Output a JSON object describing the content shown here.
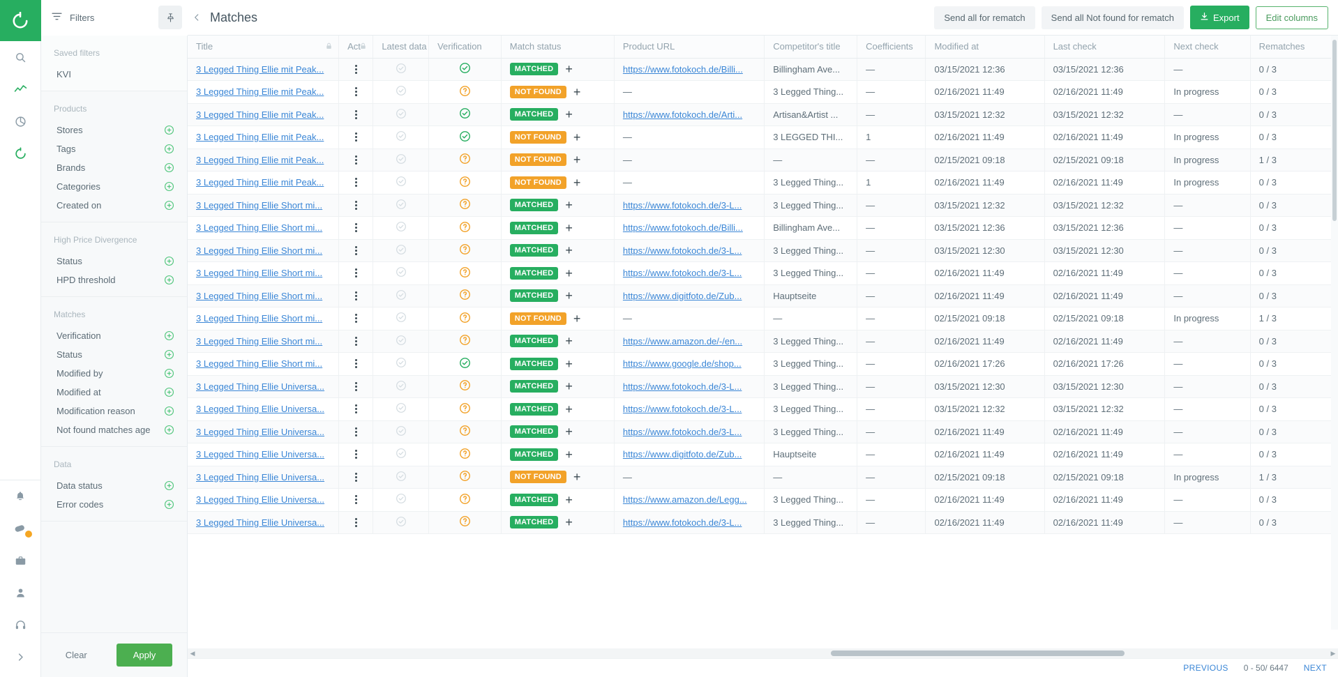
{
  "brand": {
    "logo_icon": "refresh-circle-logo",
    "accent": "#27ae60"
  },
  "rail": {
    "items": [
      {
        "name": "search",
        "icon": "search-icon"
      },
      {
        "name": "analytics",
        "icon": "chart-line-icon"
      },
      {
        "name": "reports",
        "icon": "pie-chart-icon"
      },
      {
        "name": "matches",
        "icon": "refresh-icon"
      }
    ],
    "bottom_items": [
      {
        "name": "notifications",
        "icon": "bell-icon"
      },
      {
        "name": "tasks",
        "icon": "tag-check-icon",
        "badge": true
      },
      {
        "name": "catalog",
        "icon": "briefcase-icon"
      },
      {
        "name": "users",
        "icon": "person-icon"
      },
      {
        "name": "support",
        "icon": "headset-icon"
      },
      {
        "name": "expand",
        "icon": "chevron-right-icon"
      }
    ]
  },
  "topbar": {
    "filters_label": "Filters",
    "filter_icon": "filter-icon",
    "pin_icon": "pin-icon",
    "collapse_icon": "chevron-left-icon",
    "page_title": "Matches",
    "actions": {
      "send_all": "Send all for rematch",
      "send_not_found": "Send all Not found for rematch",
      "export": "Export",
      "export_icon": "download-icon",
      "edit_columns": "Edit columns"
    }
  },
  "filters": {
    "groups": [
      {
        "title": "Saved filters",
        "has_add": true,
        "items": [
          {
            "label": "KVI",
            "has_add": false
          }
        ]
      },
      {
        "title": "Products",
        "has_add": false,
        "items": [
          {
            "label": "Stores",
            "has_add": true
          },
          {
            "label": "Tags",
            "has_add": true
          },
          {
            "label": "Brands",
            "has_add": true
          },
          {
            "label": "Categories",
            "has_add": true
          },
          {
            "label": "Created on",
            "has_add": true
          }
        ]
      },
      {
        "title": "High Price Divergence",
        "has_add": false,
        "items": [
          {
            "label": "Status",
            "has_add": true
          },
          {
            "label": "HPD threshold",
            "has_add": true
          }
        ]
      },
      {
        "title": "Matches",
        "has_add": false,
        "items": [
          {
            "label": "Verification",
            "has_add": true
          },
          {
            "label": "Status",
            "has_add": true
          },
          {
            "label": "Modified by",
            "has_add": true
          },
          {
            "label": "Modified at",
            "has_add": true
          },
          {
            "label": "Modification reason",
            "has_add": true
          },
          {
            "label": "Not found matches age",
            "has_add": true
          }
        ]
      },
      {
        "title": "Data",
        "has_add": false,
        "items": [
          {
            "label": "Data status",
            "has_add": true
          },
          {
            "label": "Error codes",
            "has_add": true
          }
        ]
      }
    ],
    "clear_label": "Clear",
    "apply_label": "Apply"
  },
  "table": {
    "columns": [
      {
        "key": "title",
        "label": "Title",
        "lock": true
      },
      {
        "key": "actions",
        "label": "Act",
        "lock": true
      },
      {
        "key": "latest_data",
        "label": "Latest data ...",
        "lock": false
      },
      {
        "key": "verification",
        "label": "Verification",
        "lock": false
      },
      {
        "key": "match_status",
        "label": "Match status",
        "lock": false
      },
      {
        "key": "product_url",
        "label": "Product URL",
        "lock": false
      },
      {
        "key": "competitor_title",
        "label": "Competitor's title",
        "lock": false
      },
      {
        "key": "coefficients",
        "label": "Coefficients",
        "lock": false
      },
      {
        "key": "modified_at",
        "label": "Modified at",
        "lock": false
      },
      {
        "key": "last_check",
        "label": "Last check",
        "lock": false
      },
      {
        "key": "next_check",
        "label": "Next check",
        "lock": false
      },
      {
        "key": "rematches",
        "label": "Rematches",
        "lock": false
      }
    ],
    "rows": [
      {
        "title": "3 Legged Thing Ellie mit Peak...",
        "latest_data": "check-circle-grey-icon",
        "verification": "check-circle-green-icon",
        "match_status": "MATCHED",
        "product_url": "https://www.fotokoch.de/Billi...",
        "competitor_title": "Billingham Ave...",
        "coefficients": "—",
        "modified_at": "03/15/2021 12:36",
        "last_check": "03/15/2021 12:36",
        "next_check": "—",
        "rematches": "0 / 3"
      },
      {
        "title": "3 Legged Thing Ellie mit Peak...",
        "latest_data": "check-circle-grey-icon",
        "verification": "question-circle-orange-icon",
        "match_status": "NOT FOUND",
        "product_url": "—",
        "competitor_title": "3 Legged Thing...",
        "coefficients": "—",
        "modified_at": "02/16/2021 11:49",
        "last_check": "02/16/2021 11:49",
        "next_check": "In progress",
        "rematches": "0 / 3"
      },
      {
        "title": "3 Legged Thing Ellie mit Peak...",
        "latest_data": "check-circle-grey-icon",
        "verification": "check-circle-green-icon",
        "match_status": "MATCHED",
        "product_url": "https://www.fotokoch.de/Arti...",
        "competitor_title": "Artisan&Artist ...",
        "coefficients": "—",
        "modified_at": "03/15/2021 12:32",
        "last_check": "03/15/2021 12:32",
        "next_check": "—",
        "rematches": "0 / 3"
      },
      {
        "title": "3 Legged Thing Ellie mit Peak...",
        "latest_data": "check-circle-grey-icon",
        "verification": "check-circle-green-icon",
        "match_status": "NOT FOUND",
        "product_url": "—",
        "competitor_title": "3 LEGGED THI...",
        "coefficients": "1",
        "modified_at": "02/16/2021 11:49",
        "last_check": "02/16/2021 11:49",
        "next_check": "In progress",
        "rematches": "0 / 3"
      },
      {
        "title": "3 Legged Thing Ellie mit Peak...",
        "latest_data": "check-circle-grey-icon",
        "verification": "question-circle-orange-icon",
        "match_status": "NOT FOUND",
        "product_url": "—",
        "competitor_title": "—",
        "coefficients": "—",
        "modified_at": "02/15/2021 09:18",
        "last_check": "02/15/2021 09:18",
        "next_check": "In progress",
        "rematches": "1 / 3"
      },
      {
        "title": "3 Legged Thing Ellie mit Peak...",
        "latest_data": "check-circle-grey-icon",
        "verification": "question-circle-orange-icon",
        "match_status": "NOT FOUND",
        "product_url": "—",
        "competitor_title": "3 Legged Thing...",
        "coefficients": "1",
        "modified_at": "02/16/2021 11:49",
        "last_check": "02/16/2021 11:49",
        "next_check": "In progress",
        "rematches": "0 / 3"
      },
      {
        "title": "3 Legged Thing Ellie Short mi...",
        "latest_data": "check-circle-grey-icon",
        "verification": "question-circle-orange-icon",
        "match_status": "MATCHED",
        "product_url": "https://www.fotokoch.de/3-L...",
        "competitor_title": "3 Legged Thing...",
        "coefficients": "—",
        "modified_at": "03/15/2021 12:32",
        "last_check": "03/15/2021 12:32",
        "next_check": "—",
        "rematches": "0 / 3"
      },
      {
        "title": "3 Legged Thing Ellie Short mi...",
        "latest_data": "check-circle-grey-icon",
        "verification": "question-circle-orange-icon",
        "match_status": "MATCHED",
        "product_url": "https://www.fotokoch.de/Billi...",
        "competitor_title": "Billingham Ave...",
        "coefficients": "—",
        "modified_at": "03/15/2021 12:36",
        "last_check": "03/15/2021 12:36",
        "next_check": "—",
        "rematches": "0 / 3"
      },
      {
        "title": "3 Legged Thing Ellie Short mi...",
        "latest_data": "check-circle-grey-icon",
        "verification": "question-circle-orange-icon",
        "match_status": "MATCHED",
        "product_url": "https://www.fotokoch.de/3-L...",
        "competitor_title": "3 Legged Thing...",
        "coefficients": "—",
        "modified_at": "03/15/2021 12:30",
        "last_check": "03/15/2021 12:30",
        "next_check": "—",
        "rematches": "0 / 3"
      },
      {
        "title": "3 Legged Thing Ellie Short mi...",
        "latest_data": "check-circle-grey-icon",
        "verification": "question-circle-orange-icon",
        "match_status": "MATCHED",
        "product_url": "https://www.fotokoch.de/3-L...",
        "competitor_title": "3 Legged Thing...",
        "coefficients": "—",
        "modified_at": "02/16/2021 11:49",
        "last_check": "02/16/2021 11:49",
        "next_check": "—",
        "rematches": "0 / 3"
      },
      {
        "title": "3 Legged Thing Ellie Short mi...",
        "latest_data": "check-circle-grey-icon",
        "verification": "question-circle-orange-icon",
        "match_status": "MATCHED",
        "product_url": "https://www.digitfoto.de/Zub...",
        "competitor_title": "Hauptseite",
        "coefficients": "—",
        "modified_at": "02/16/2021 11:49",
        "last_check": "02/16/2021 11:49",
        "next_check": "—",
        "rematches": "0 / 3"
      },
      {
        "title": "3 Legged Thing Ellie Short mi...",
        "latest_data": "check-circle-grey-icon",
        "verification": "question-circle-orange-icon",
        "match_status": "NOT FOUND",
        "product_url": "—",
        "competitor_title": "—",
        "coefficients": "—",
        "modified_at": "02/15/2021 09:18",
        "last_check": "02/15/2021 09:18",
        "next_check": "In progress",
        "rematches": "1 / 3"
      },
      {
        "title": "3 Legged Thing Ellie Short mi...",
        "latest_data": "check-circle-grey-icon",
        "verification": "question-circle-orange-icon",
        "match_status": "MATCHED",
        "product_url": "https://www.amazon.de/-/en...",
        "competitor_title": "3 Legged Thing...",
        "coefficients": "—",
        "modified_at": "02/16/2021 11:49",
        "last_check": "02/16/2021 11:49",
        "next_check": "—",
        "rematches": "0 / 3"
      },
      {
        "title": "3 Legged Thing Ellie Short mi...",
        "latest_data": "check-circle-grey-icon",
        "verification": "check-circle-green-icon",
        "match_status": "MATCHED",
        "product_url": "https://www.google.de/shop...",
        "competitor_title": "3 Legged Thing...",
        "coefficients": "—",
        "modified_at": "02/16/2021 17:26",
        "last_check": "02/16/2021 17:26",
        "next_check": "—",
        "rematches": "0 / 3"
      },
      {
        "title": "3 Legged Thing Ellie Universa...",
        "latest_data": "check-circle-grey-icon",
        "verification": "question-circle-orange-icon",
        "match_status": "MATCHED",
        "product_url": "https://www.fotokoch.de/3-L...",
        "competitor_title": "3 Legged Thing...",
        "coefficients": "—",
        "modified_at": "03/15/2021 12:30",
        "last_check": "03/15/2021 12:30",
        "next_check": "—",
        "rematches": "0 / 3"
      },
      {
        "title": "3 Legged Thing Ellie Universa...",
        "latest_data": "check-circle-grey-icon",
        "verification": "question-circle-orange-icon",
        "match_status": "MATCHED",
        "product_url": "https://www.fotokoch.de/3-L...",
        "competitor_title": "3 Legged Thing...",
        "coefficients": "—",
        "modified_at": "03/15/2021 12:32",
        "last_check": "03/15/2021 12:32",
        "next_check": "—",
        "rematches": "0 / 3"
      },
      {
        "title": "3 Legged Thing Ellie Universa...",
        "latest_data": "check-circle-grey-icon",
        "verification": "question-circle-orange-icon",
        "match_status": "MATCHED",
        "product_url": "https://www.fotokoch.de/3-L...",
        "competitor_title": "3 Legged Thing...",
        "coefficients": "—",
        "modified_at": "02/16/2021 11:49",
        "last_check": "02/16/2021 11:49",
        "next_check": "—",
        "rematches": "0 / 3"
      },
      {
        "title": "3 Legged Thing Ellie Universa...",
        "latest_data": "check-circle-grey-icon",
        "verification": "question-circle-orange-icon",
        "match_status": "MATCHED",
        "product_url": "https://www.digitfoto.de/Zub...",
        "competitor_title": "Hauptseite",
        "coefficients": "—",
        "modified_at": "02/16/2021 11:49",
        "last_check": "02/16/2021 11:49",
        "next_check": "—",
        "rematches": "0 / 3"
      },
      {
        "title": "3 Legged Thing Ellie Universa...",
        "latest_data": "check-circle-grey-icon",
        "verification": "question-circle-orange-icon",
        "match_status": "NOT FOUND",
        "product_url": "—",
        "competitor_title": "—",
        "coefficients": "—",
        "modified_at": "02/15/2021 09:18",
        "last_check": "02/15/2021 09:18",
        "next_check": "In progress",
        "rematches": "1 / 3"
      },
      {
        "title": "3 Legged Thing Ellie Universa...",
        "latest_data": "check-circle-grey-icon",
        "verification": "question-circle-orange-icon",
        "match_status": "MATCHED",
        "product_url": "https://www.amazon.de/Legg...",
        "competitor_title": "3 Legged Thing...",
        "coefficients": "—",
        "modified_at": "02/16/2021 11:49",
        "last_check": "02/16/2021 11:49",
        "next_check": "—",
        "rematches": "0 / 3"
      },
      {
        "title": "3 Legged Thing Ellie Universa...",
        "latest_data": "check-circle-grey-icon",
        "verification": "question-circle-orange-icon",
        "match_status": "MATCHED",
        "product_url": "https://www.fotokoch.de/3-L...",
        "competitor_title": "3 Legged Thing...",
        "coefficients": "—",
        "modified_at": "02/16/2021 11:49",
        "last_check": "02/16/2021 11:49",
        "next_check": "—",
        "rematches": "0 / 3"
      }
    ]
  },
  "footer": {
    "previous": "PREVIOUS",
    "range": "0 - 50/ 6447",
    "next": "NEXT"
  }
}
